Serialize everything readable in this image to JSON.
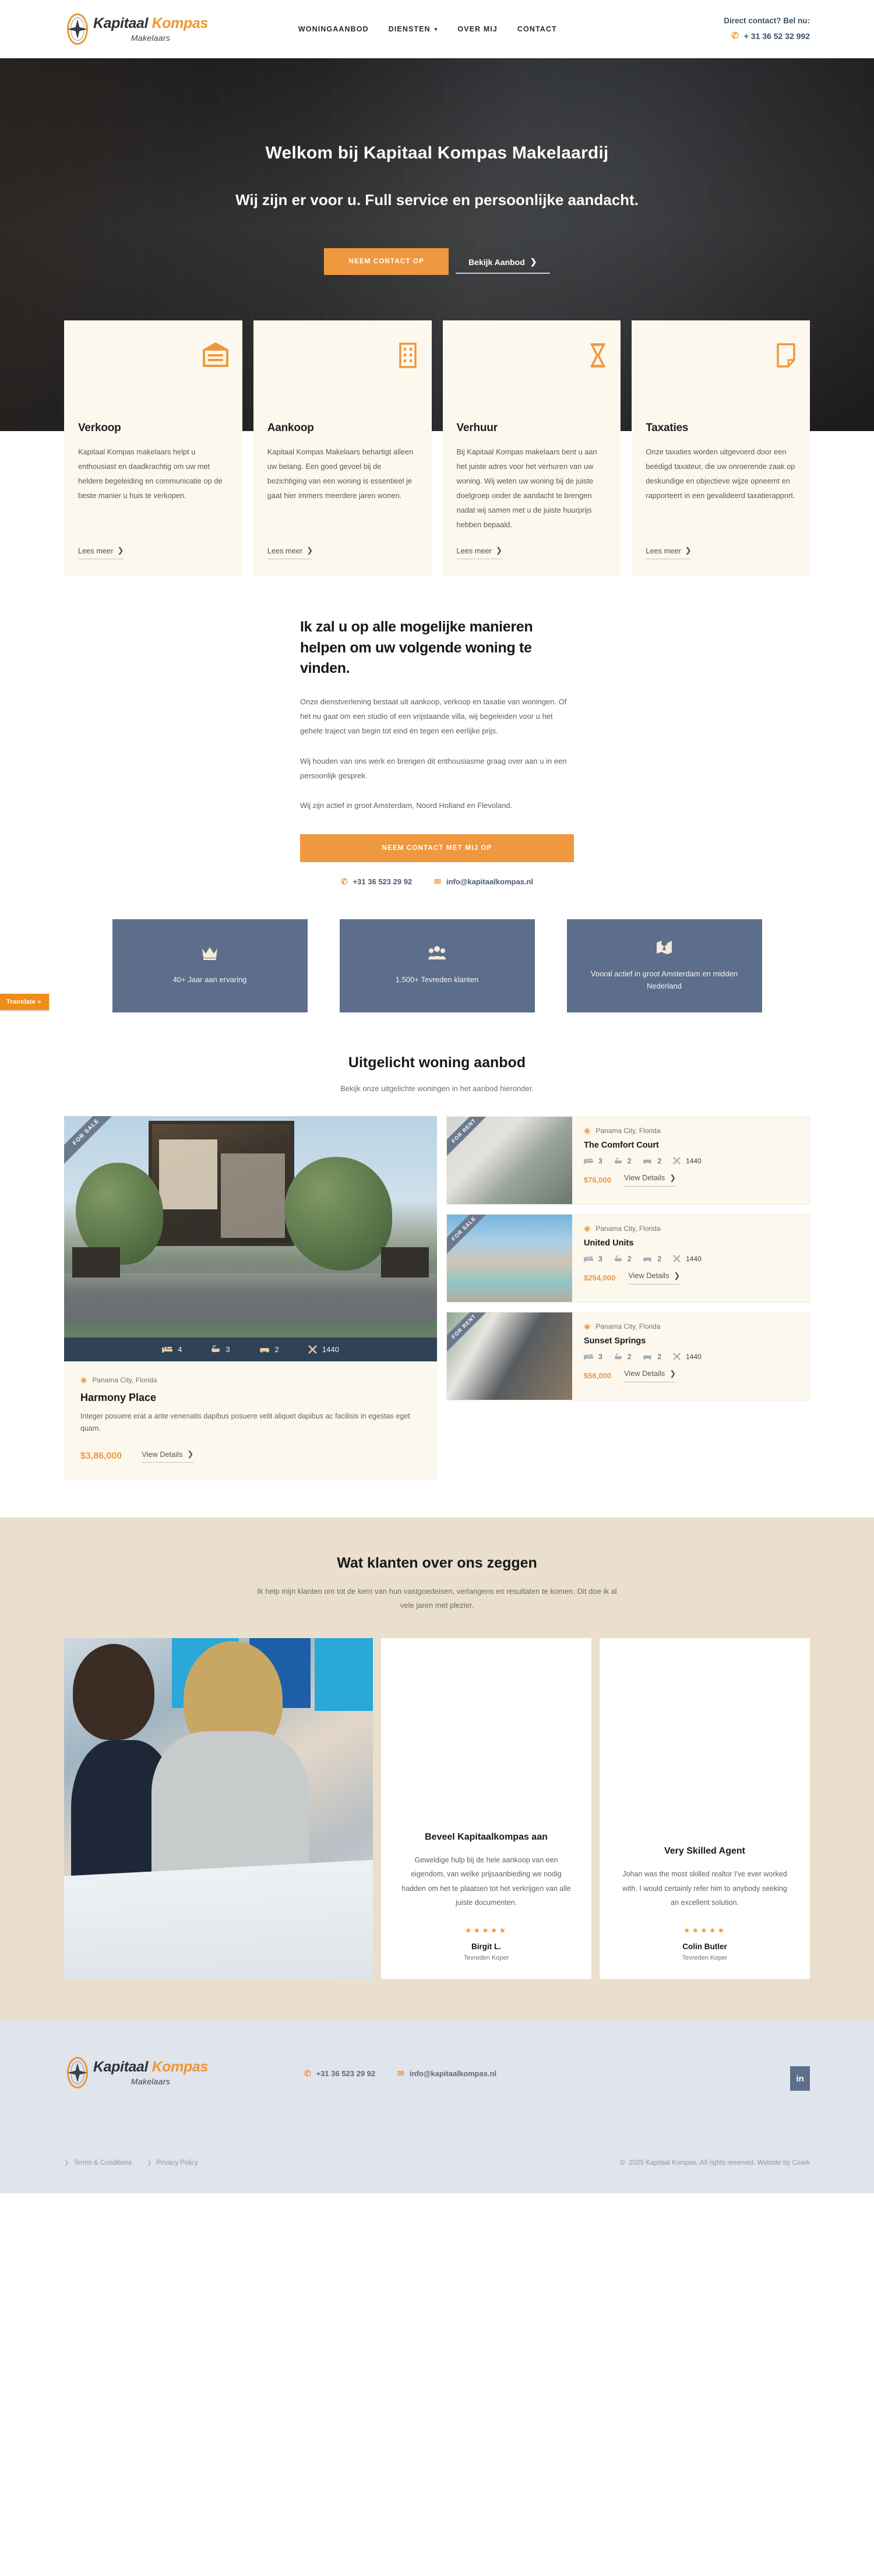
{
  "header": {
    "brand": {
      "word1": "Kapitaal",
      "word2": "Kompas",
      "sub": "Makelaars"
    },
    "nav": [
      {
        "label": "WONINGAANBOD",
        "has_caret": false
      },
      {
        "label": "DIENSTEN",
        "has_caret": true
      },
      {
        "label": "OVER MIJ",
        "has_caret": false
      },
      {
        "label": "CONTACT",
        "has_caret": false
      }
    ],
    "contact_label": "Direct contact? Bel nu:",
    "contact_phone": "+ 31 36 52 32 992"
  },
  "translate_tab": "Translate »",
  "hero": {
    "title": "Welkom bij Kapitaal Kompas Makelaardij",
    "subtitle": "Wij zijn er voor u. Full service en persoonlijke aandacht.",
    "primary_button": "NEEM CONTACT OP",
    "secondary_button": "Bekijk Aanbod"
  },
  "services": [
    {
      "icon": "warehouse-icon",
      "title": "Verkoop",
      "body": "Kapitaal Kompas makelaars helpt u enthousiast en daadkrachtig om uw met heldere begeleiding en communicatie op de beste manier u huis te verkopen.",
      "link": "Lees meer"
    },
    {
      "icon": "building-icon",
      "title": "Aankoop",
      "body": "Kapitaal Kompas Makelaars behartigt alleen uw belang. Een goed gevoel bij de bezichtiging van een woning is essentieel je gaat hier immers meerdere jaren wonen.",
      "link": "Lees meer"
    },
    {
      "icon": "hourglass-icon",
      "title": "Verhuur",
      "body": "Bij Kapitaal Kompas makelaars bent u aan het juiste adres voor het verhuren van uw woning. Wij weten uw woning bij de juiste doelgroep onder de aandacht te brengen nadat wij samen met u de juiste huurprijs hebben bepaald.",
      "link": "Lees meer"
    },
    {
      "icon": "document-icon",
      "title": "Taxaties",
      "body": "Onze taxaties worden uitgevoerd door een beëdigd taxateur, die uw onroerende zaak op deskundige en objectieve wijze opneemt en rapporteert in een gevalideerd taxatierapport.",
      "link": "Lees meer"
    }
  ],
  "about": {
    "heading": "Ik zal u op alle mogelijke manieren helpen om uw volgende woning te vinden.",
    "paragraphs": [
      "Onze dienstverlening bestaat uit aankoop, verkoop en taxatie van woningen. Of het nu gaat om een studio of een vrijstaande villa, wij begeleiden voor u het gehele traject van begin tot eind én tegen een eerlijke prijs.",
      "Wij houden van ons werk en brengen dit enthousiasme graag over aan u in een persoonlijk gesprek.",
      "Wij zijn actief in groot Amsterdam, Noord Holland en Flevoland."
    ],
    "cta": "NEEM CONTACT MET MIJ OP",
    "phone": "+31 36 523 29 92",
    "email": "info@kapitaalkompas.nl"
  },
  "stats": [
    {
      "icon": "crown-icon",
      "label": "40+ Jaar aan ervaring"
    },
    {
      "icon": "people-icon",
      "label": "1.500+ Tevreden klanten"
    },
    {
      "icon": "map-pin-icon",
      "label": "Vooral actief in groot Amsterdam en midden Nederland"
    }
  ],
  "listings": {
    "title": "Uitgelicht woning aanbod",
    "subtitle": "Bekijk onze uitgelichte woningen in het aanbod hieronder.",
    "featured": {
      "badge": "FOR SALE",
      "location": "Panama City, Florida",
      "title": "Harmony Place",
      "description": "Integer posuere erat a ante venenatis dapibus posuere velit aliquet dapibus ac facilisis in egestas eget quam.",
      "beds": "4",
      "baths": "3",
      "garage": "2",
      "area": "1440",
      "price": "$3,86,000",
      "view": "View Details"
    },
    "side": [
      {
        "badge": "FOR RENT",
        "location": "Panama City, Florida",
        "title": "The Comfort Court",
        "beds": "3",
        "baths": "2",
        "garage": "2",
        "area": "1440",
        "price": "$76,000",
        "view": "View Details"
      },
      {
        "badge": "FOR SALE",
        "location": "Panama City, Florida",
        "title": "United Units",
        "beds": "3",
        "baths": "2",
        "garage": "2",
        "area": "1440",
        "price": "$254,000",
        "view": "View Details"
      },
      {
        "badge": "FOR RENT",
        "location": "Panama City, Florida",
        "title": "Sunset Springs",
        "beds": "3",
        "baths": "2",
        "garage": "2",
        "area": "1440",
        "price": "$56,000",
        "view": "View Details"
      }
    ]
  },
  "testimonials": {
    "title": "Wat klanten over ons zeggen",
    "subtitle": "Ik help mijn klanten om tot de kern van hun vastgoedeisen, verlangens en resultaten te komen. Dit doe ik al vele jaren met plezier.",
    "items": [
      {
        "title": "Beveel Kapitaalkompas aan",
        "text": "Geweldige hulp bij de hele aankoop van een eigendom, van welke prijsaanbieding we nodig hadden om het te plaatsen tot het verkrijgen van alle juiste documenten.",
        "stars": "★★★★★",
        "name": "Birgit L.",
        "role": "Tevreden Koper"
      },
      {
        "title": "Very Skilled Agent",
        "text": "Johan was the most skilled realtor I've ever worked with. I would certainly refer him to anybody seeking an excellent solution.",
        "stars": "★★★★★",
        "name": "Colin Butler",
        "role": "Tevreden Koper"
      }
    ]
  },
  "footer": {
    "brand": {
      "word1": "Kapitaal",
      "word2": "Kompas",
      "sub": "Makelaars"
    },
    "phone": "+31 36 523 29 92",
    "email": "info@kapitaalkompas.nl",
    "social": "in",
    "links": [
      "Terms & Conditions",
      "Privacy Policy"
    ],
    "copyright": "2025 Kapitaal Kompas. All rights reserved. Website by Coark",
    "copyright_symbol": "©"
  },
  "colors": {
    "accent_orange": "#ef9840",
    "deep_blue": "#2f4257",
    "slate_blue": "#5c6e8c",
    "cream": "#fdf8ed",
    "sand": "#e9dfcc",
    "footer_bg": "#dfe4ed"
  }
}
